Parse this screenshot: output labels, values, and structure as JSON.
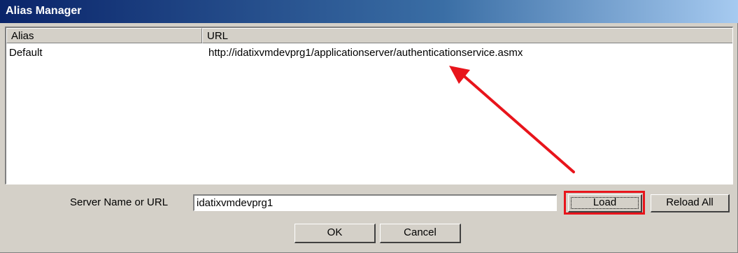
{
  "window": {
    "title": "Alias Manager"
  },
  "list": {
    "columns": [
      "Alias",
      "URL"
    ],
    "rows": [
      {
        "alias": "Default",
        "url": "http://idatixvmdevprg1/applicationserver/authenticationservice.asmx"
      }
    ]
  },
  "server": {
    "label": "Server Name or URL",
    "value": "idatixvmdevprg1"
  },
  "buttons": {
    "load": "Load",
    "reload_all": "Reload All",
    "ok": "OK",
    "cancel": "Cancel"
  },
  "annotation": {
    "color": "#e8141b"
  }
}
